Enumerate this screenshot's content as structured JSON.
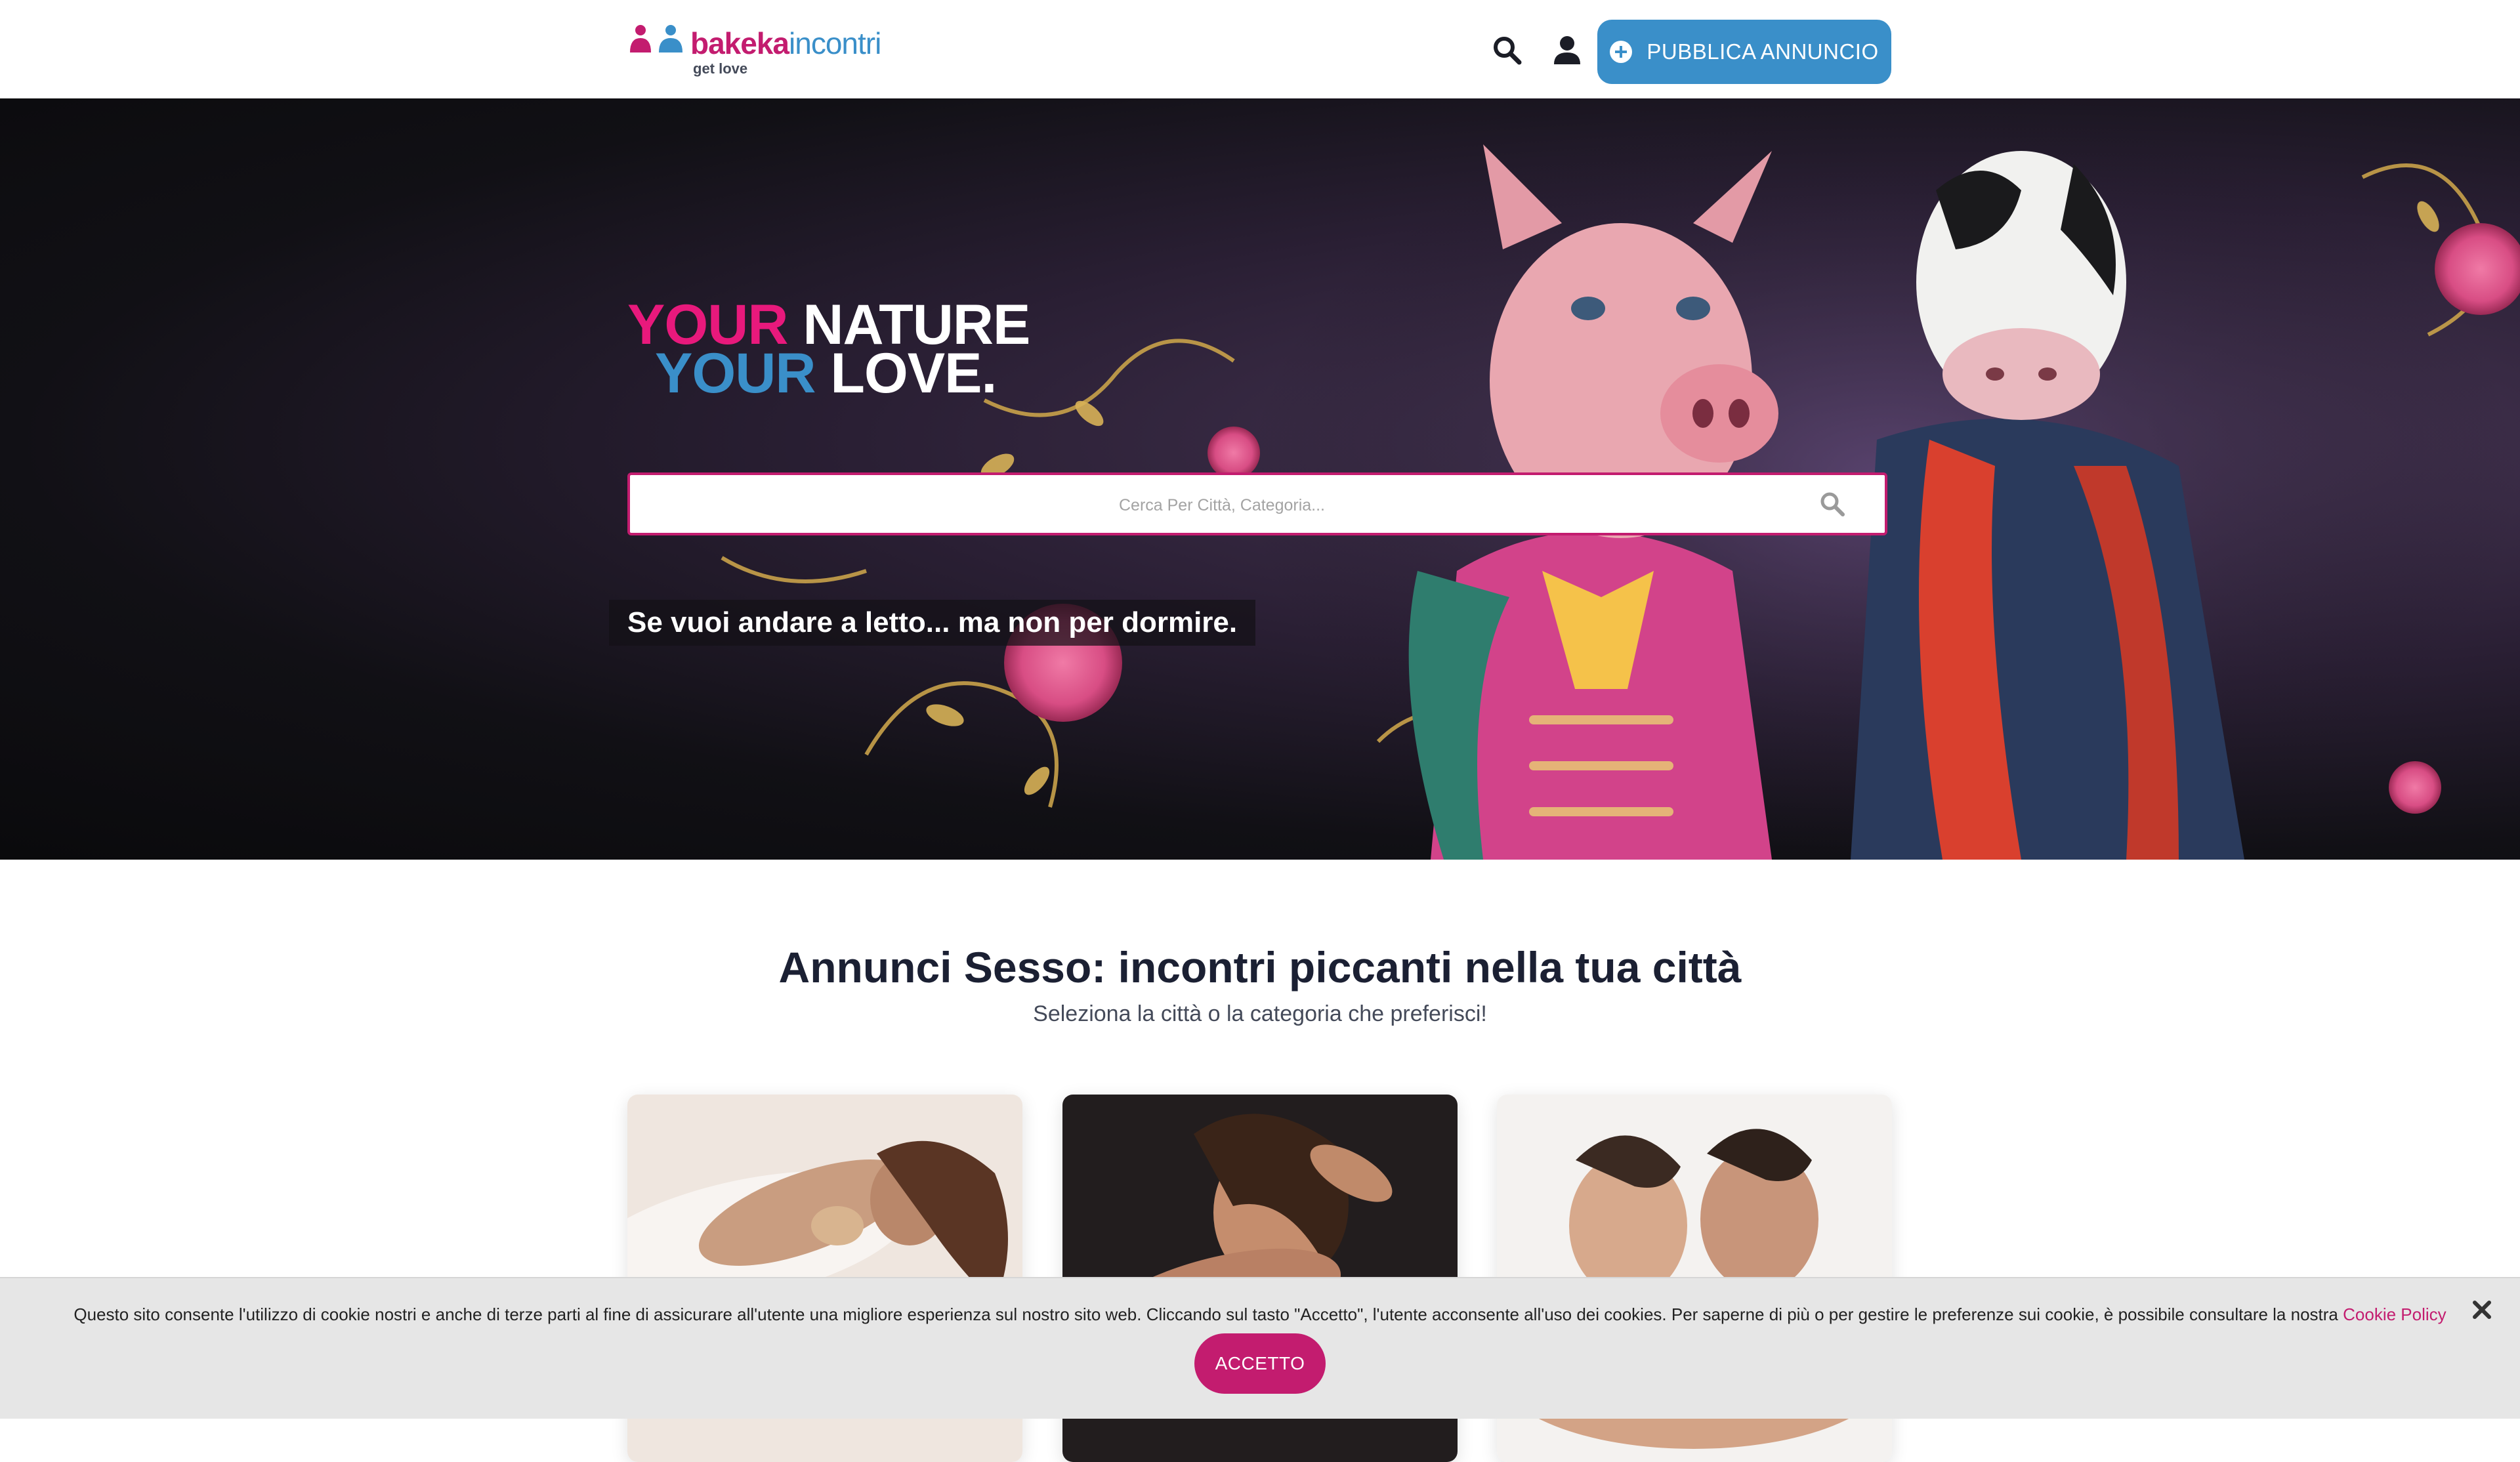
{
  "header": {
    "logo_text_a": "bakeka",
    "logo_text_b": "incontri",
    "logo_tagline": "get love",
    "search_icon": "search-icon",
    "user_icon": "user-icon",
    "publish_label": "PUBBLICA ANNUNCIO"
  },
  "hero": {
    "headline_word1": "YOUR",
    "headline_word2": "NATURE",
    "headline_word3": "YOUR",
    "headline_word4": "LOVE.",
    "search_placeholder": "Cerca Per Città, Categoria...",
    "tagline": "Se vuoi andare a letto... ma non per dormire."
  },
  "main": {
    "title": "Annunci Sesso: incontri piccanti nella tua città",
    "subtitle": "Seleziona la città o la categoria che preferisci!"
  },
  "cookie": {
    "text": "Questo sito consente l'utilizzo di cookie nostri e anche di terze parti al fine di assicurare all'utente una migliore esperienza sul nostro sito web. Cliccando sul tasto \"Accetto\", l'utente acconsente all'uso dei cookies. Per saperne di più o per gestire le preferenze sui cookie, è possibile consultare la nostra",
    "link_label": "Cookie Policy",
    "accept_label": "ACCETTO"
  },
  "colors": {
    "brand_pink": "#c31c6f",
    "brand_blue": "#3a8fc9",
    "headline_pink": "#e8197c"
  }
}
